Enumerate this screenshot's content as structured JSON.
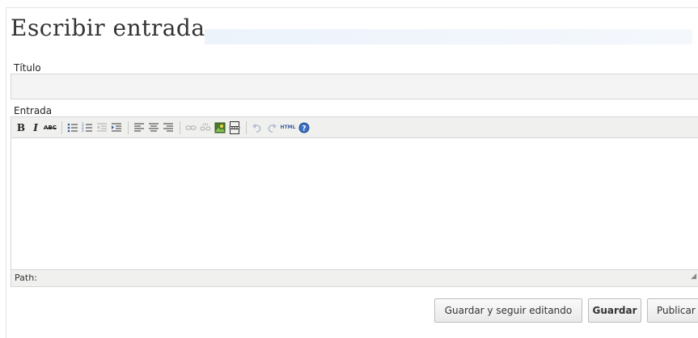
{
  "page": {
    "title": "Escribir entrada"
  },
  "fields": {
    "title_label": "Título",
    "title_value": "",
    "entry_label": "Entrada"
  },
  "editor": {
    "toolbar": [
      {
        "name": "bold-icon",
        "glyph": "B"
      },
      {
        "name": "italic-icon",
        "glyph": "I"
      },
      {
        "name": "strikethrough-icon",
        "glyph": "ABC"
      },
      {
        "name": "unordered-list-icon",
        "glyph": "☰"
      },
      {
        "name": "ordered-list-icon",
        "glyph": "☷"
      },
      {
        "name": "outdent-icon",
        "glyph": "⇤"
      },
      {
        "name": "indent-icon",
        "glyph": "⇥"
      },
      {
        "name": "align-left-icon",
        "glyph": "≡"
      },
      {
        "name": "align-center-icon",
        "glyph": "≣"
      },
      {
        "name": "align-right-icon",
        "glyph": "≡"
      },
      {
        "name": "link-icon",
        "glyph": "∞"
      },
      {
        "name": "unlink-icon",
        "glyph": "✂"
      },
      {
        "name": "image-icon",
        "glyph": "▣"
      },
      {
        "name": "page-break-icon",
        "glyph": "▤"
      },
      {
        "name": "undo-icon",
        "glyph": "↶"
      },
      {
        "name": "redo-icon",
        "glyph": "↷"
      },
      {
        "name": "html-icon",
        "glyph": "HTML"
      },
      {
        "name": "help-icon",
        "glyph": "?"
      }
    ],
    "path_label": "Path:"
  },
  "actions": {
    "save_continue": "Guardar y seguir editando",
    "save": "Guardar",
    "publish": "Publicar"
  }
}
